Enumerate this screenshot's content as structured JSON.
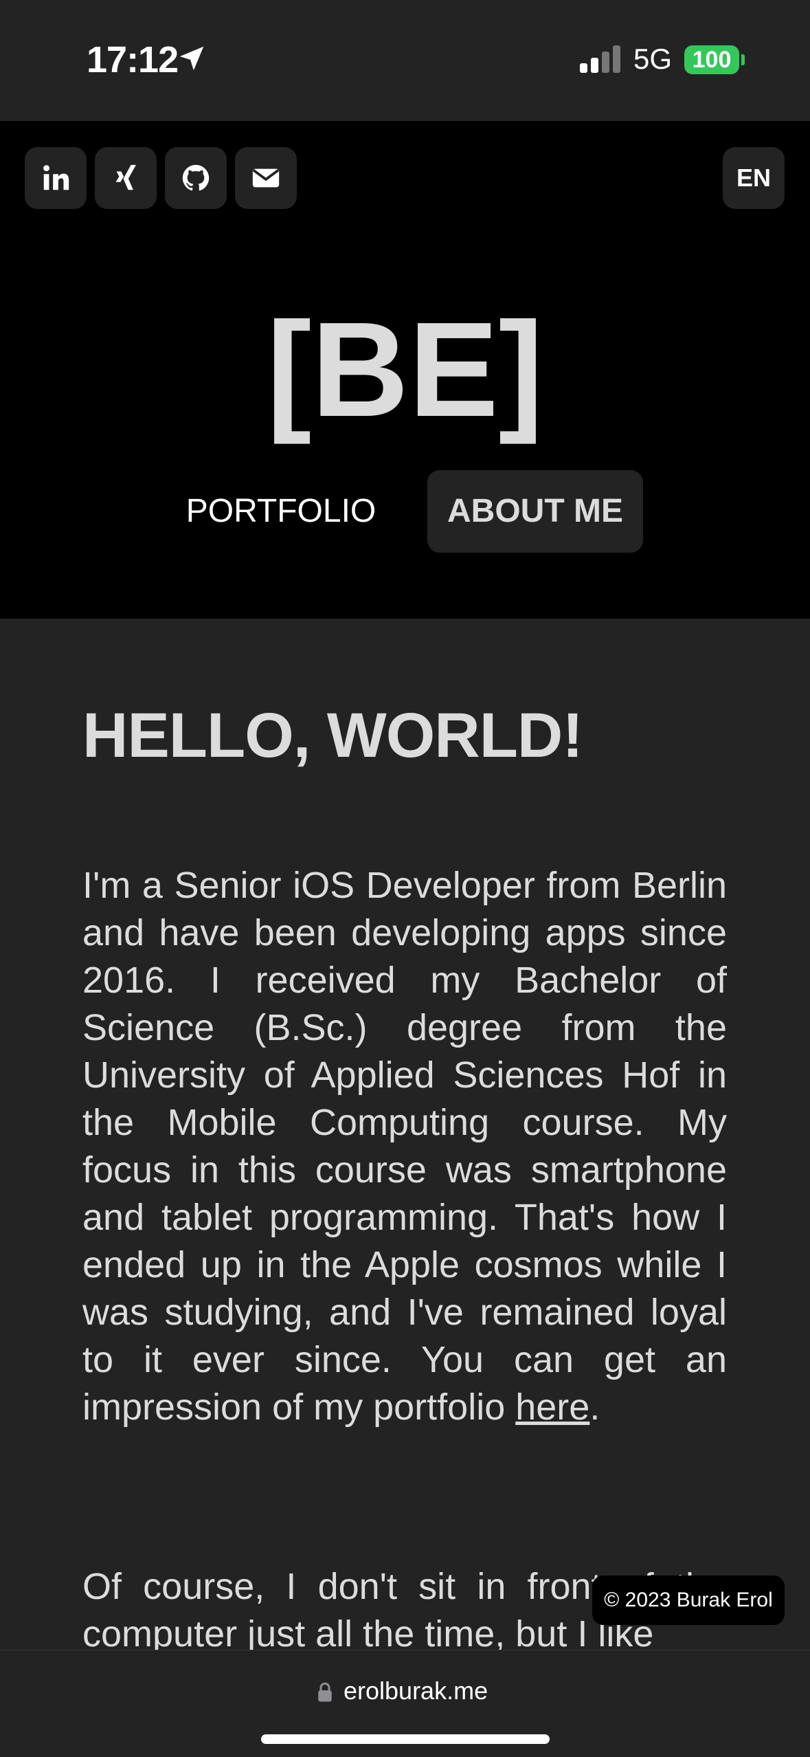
{
  "status_bar": {
    "time": "17:12",
    "network": "5G",
    "battery": "100",
    "icons": [
      "location-arrow-icon",
      "signal-icon",
      "battery-icon"
    ]
  },
  "header": {
    "social_links": [
      {
        "name": "linkedin",
        "icon": "linkedin-icon"
      },
      {
        "name": "xing",
        "icon": "xing-icon"
      },
      {
        "name": "github",
        "icon": "github-icon"
      },
      {
        "name": "email",
        "icon": "envelope-icon"
      }
    ],
    "language": "EN",
    "logo": "[BE]",
    "nav": {
      "portfolio": "PORTFOLIO",
      "about": "ABOUT ME"
    }
  },
  "main": {
    "heading": "HELLO, WORLD!",
    "paragraph1_text": "I'm a Senior iOS Developer from Berlin and have been developing apps since 2016. I received my Bachelor of Science (B.Sc.) degree from the University of Applied Sciences Hof in the Mobile Computing course. My focus in this course was smartphone and tablet programming. That's how I ended up in the Apple cosmos while I was studying, and I've remained loyal to it ever since. You can get an impression of my portfolio ",
    "paragraph1_link": "here",
    "paragraph1_end": ".",
    "paragraph2": "Of course, I don't sit in front of the computer just all the time, but I like"
  },
  "footer": {
    "copyright": "© 2023 Burak Erol"
  },
  "browser": {
    "url": "erolburak.me"
  },
  "colors": {
    "background": "#232324",
    "header_bg": "#000000",
    "text": "#dcdcdc",
    "battery": "#34c759"
  }
}
